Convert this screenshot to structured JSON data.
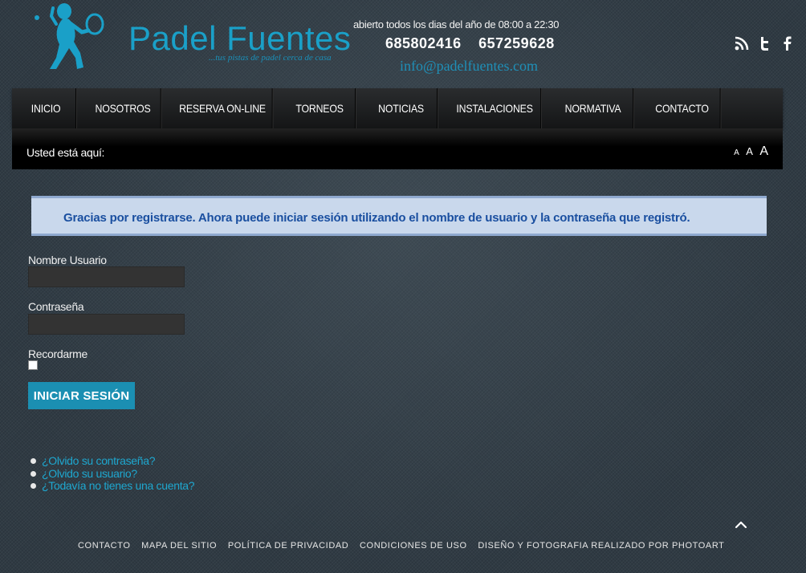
{
  "header": {
    "logo_name_part1": "Padel",
    "logo_name_part2": "Fuentes",
    "logo_tagline": "...tus pistas de padel cerca de casa",
    "hours": "abierto todos los dias del año de 08:00 a 22:30",
    "phone1": "685802416",
    "phone2": "657259628",
    "email": "info@padelfuentes.com",
    "social": [
      "rss-icon",
      "twitter-icon",
      "facebook-icon"
    ],
    "brand_color": "#1aa0c8"
  },
  "nav": {
    "items": [
      "INICIO",
      "NOSOTROS",
      "RESERVA ON-LINE",
      "TORNEOS",
      "NOTICIAS",
      "INSTALACIONES",
      "NORMATIVA",
      "CONTACTO"
    ]
  },
  "breadcrumb": {
    "label": "Usted está aquí:",
    "font_sizes": [
      "A",
      "A",
      "A"
    ]
  },
  "message": {
    "text": "Gracias por registrarse. Ahora puede iniciar sesión utilizando el nombre de usuario y la contraseña que registró."
  },
  "login": {
    "username_label": "Nombre Usuario",
    "username_value": "",
    "password_label": "Contraseña",
    "password_value": "",
    "remember_label": "Recordarme",
    "remember_checked": false,
    "submit_label": "INICIAR SESIÓN"
  },
  "links": [
    "¿Olvido su contraseña?",
    "¿Olvido su usuario?",
    "¿Todavía no tienes una cuenta?"
  ],
  "footer": {
    "items": [
      "CONTACTO",
      "MAPA DEL SITIO",
      "POLÍTICA DE PRIVACIDAD",
      "CONDICIONES DE USO",
      "DISEÑO Y FOTOGRAFIA REALIZADO POR PHOTOART"
    ]
  }
}
